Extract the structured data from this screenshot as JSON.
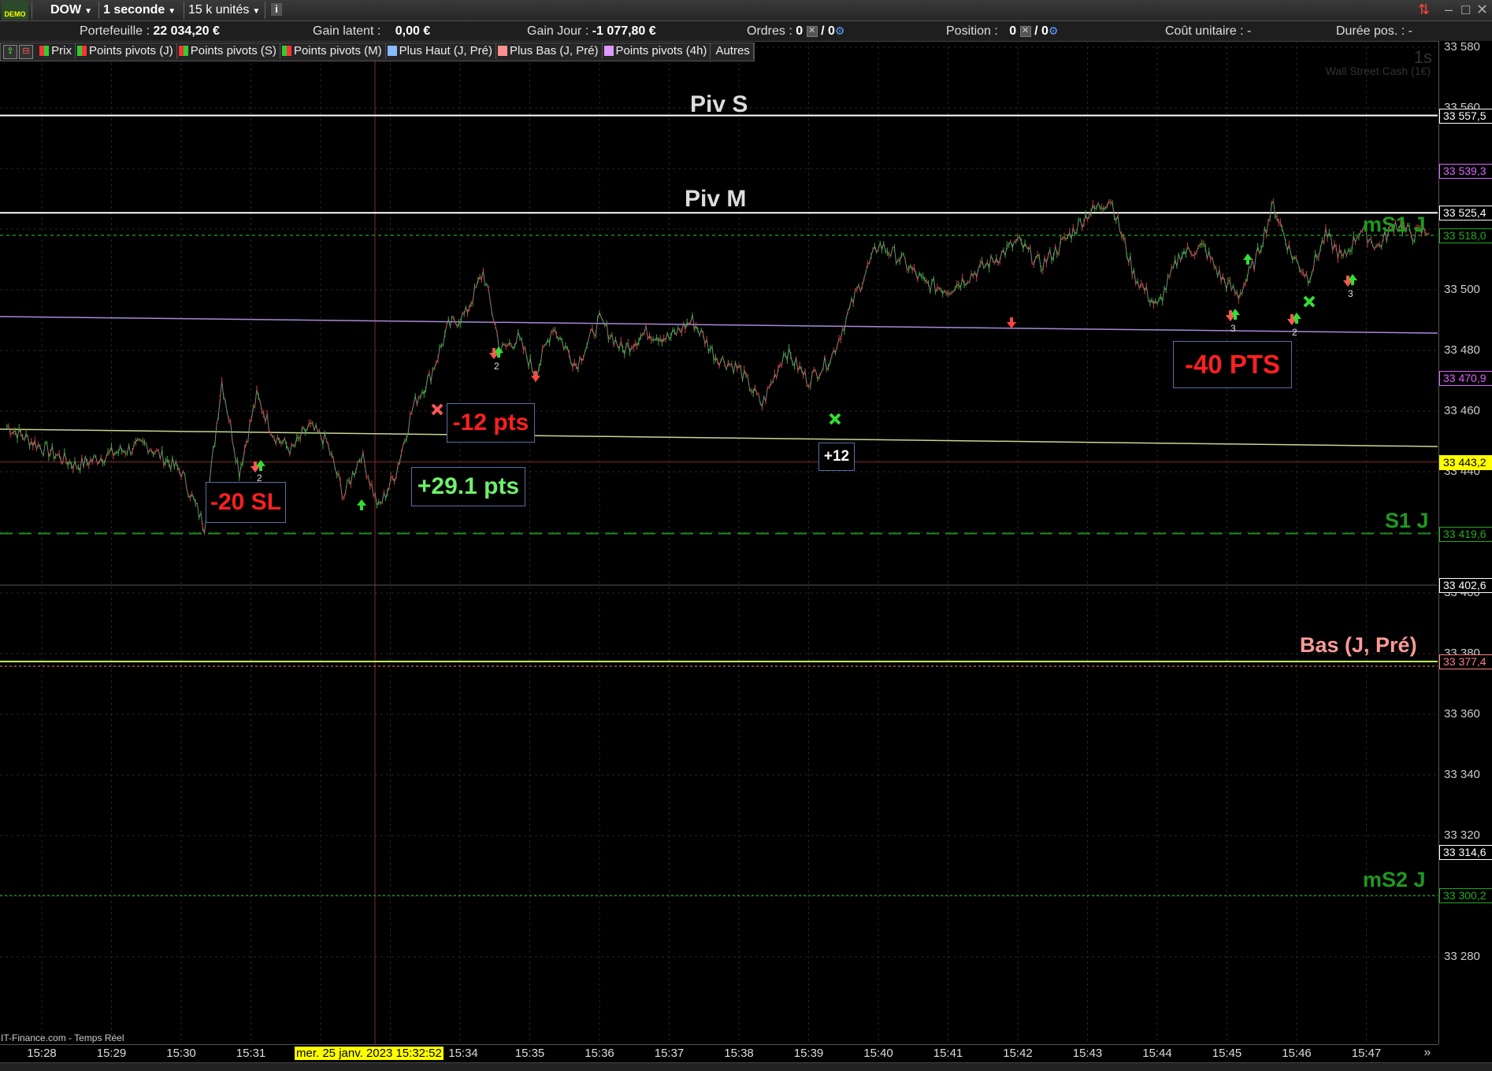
{
  "toolbar": {
    "demo_label": "DEMO",
    "instrument": "DOW",
    "period": "1 seconde",
    "units": "15 k unités",
    "info_icon": "i"
  },
  "infobar": {
    "portfolio_label": "Portefeuille :",
    "portfolio_value": "22 034,20 €",
    "latent_label": "Gain latent :",
    "latent_value": "0,00 €",
    "day_label": "Gain Jour :",
    "day_value": "-1 077,80 €",
    "orders_label": "Ordres :",
    "orders_a": "0",
    "orders_b": "/ 0",
    "position_label": "Position :",
    "position_a": "0",
    "position_b": "/ 0",
    "unit_cost_label": "Coût unitaire : -",
    "duration_label": "Durée pos. : -"
  },
  "legend": {
    "items": [
      {
        "label": "Prix",
        "color": "#33cc33"
      },
      {
        "label": "Points pivots (J)",
        "color": "#33cc33"
      },
      {
        "label": "Points pivots (S)",
        "color": "#ff3333"
      },
      {
        "label": "Points pivots (M)",
        "color": "#33cc33"
      },
      {
        "label": "Plus Haut (J, Pré)",
        "color": "#88bbff"
      },
      {
        "label": "Plus Bas (J, Pré)",
        "color": "#ff9090"
      },
      {
        "label": "Points pivots (4h)",
        "color": "#dd99ff"
      },
      {
        "label": "Autres",
        "color": ""
      }
    ]
  },
  "watermark": {
    "period": "1s",
    "instrument": "Wall Street Cash (1€)"
  },
  "chart_labels": {
    "piv_s": "Piv S",
    "piv_m": "Piv M",
    "ms1": "mS1 J",
    "s1": "S1 J",
    "bas": "Bas (J, Pré)",
    "ms2": "mS2 J"
  },
  "trade_boxes": {
    "sl20": "-20 SL",
    "pts12": "-12 pts",
    "pts29": "+29.1 pts",
    "plus12": "+12",
    "pts40": "-40 PTS"
  },
  "marker_counts": {
    "a": "2",
    "b": "2",
    "c": "3",
    "d": "2",
    "e": "3"
  },
  "price_axis": {
    "ticks": [
      "33 580",
      "33 560",
      "33 500",
      "33 480",
      "33 460",
      "33 440",
      "33 400",
      "33 380",
      "33 360",
      "33 340",
      "33 320",
      "33 280"
    ],
    "tags": [
      {
        "value": "33 557,5",
        "color": "#ffffff"
      },
      {
        "value": "33 539,3",
        "color": "#dd66ff"
      },
      {
        "value": "33 525,4",
        "color": "#ffffff"
      },
      {
        "value": "33 518,0",
        "color": "#22aa22"
      },
      {
        "value": "33 470,9",
        "color": "#dd66ff"
      },
      {
        "value": "33 443,2",
        "color": "#ffff00"
      },
      {
        "value": "33 419,6",
        "color": "#22aa22"
      },
      {
        "value": "33 402,6",
        "color": "#ffffff"
      },
      {
        "value": "33 377,4",
        "color": "#ff8080"
      },
      {
        "value": "33 314,6",
        "color": "#ffffff"
      },
      {
        "value": "33 300,2",
        "color": "#22aa22"
      }
    ]
  },
  "time_axis": {
    "ticks": [
      "15:28",
      "15:29",
      "15:30",
      "15:31",
      "15:34",
      "15:35",
      "15:36",
      "15:37",
      "15:38",
      "15:39",
      "15:40",
      "15:41",
      "15:42",
      "15:43",
      "15:44",
      "15:45",
      "15:46",
      "15:47"
    ],
    "cursor_date": "mer. 25 janv. 2023 15:32:52"
  },
  "source": "IT-Finance.com - Temps Réel",
  "chart_data": {
    "type": "line",
    "title": "",
    "x_unit": "time",
    "ylim": [
      33270,
      33585
    ],
    "x": [
      "15:27:30",
      "15:28:00",
      "15:28:30",
      "15:29:00",
      "15:29:30",
      "15:30:00",
      "15:30:20",
      "15:30:35",
      "15:30:50",
      "15:31:05",
      "15:31:20",
      "15:31:35",
      "15:31:50",
      "15:32:05",
      "15:32:20",
      "15:32:35",
      "15:32:50",
      "15:33:05",
      "15:33:20",
      "15:33:35",
      "15:33:50",
      "15:34:05",
      "15:34:20",
      "15:34:35",
      "15:34:50",
      "15:35:05",
      "15:35:20",
      "15:35:40",
      "15:36:00",
      "15:36:20",
      "15:36:40",
      "15:37:00",
      "15:37:20",
      "15:37:40",
      "15:38:00",
      "15:38:20",
      "15:38:40",
      "15:39:00",
      "15:39:20",
      "15:39:40",
      "15:40:00",
      "15:40:20",
      "15:40:40",
      "15:41:00",
      "15:41:20",
      "15:41:40",
      "15:42:00",
      "15:42:20",
      "15:42:40",
      "15:43:00",
      "15:43:20",
      "15:43:40",
      "15:44:00",
      "15:44:20",
      "15:44:40",
      "15:44:55",
      "15:45:10",
      "15:45:25",
      "15:45:40",
      "15:45:55",
      "15:46:10",
      "15:46:25",
      "15:46:40",
      "15:46:55",
      "15:47:10",
      "15:47:25",
      "15:47:40",
      "15:47:55"
    ],
    "y": [
      33455,
      33448,
      33442,
      33446,
      33449,
      33440,
      33422,
      33470,
      33440,
      33465,
      33452,
      33447,
      33455,
      33450,
      33432,
      33446,
      33428,
      33440,
      33462,
      33472,
      33488,
      33492,
      33506,
      33480,
      33484,
      33472,
      33488,
      33475,
      33490,
      33480,
      33486,
      33484,
      33490,
      33478,
      33474,
      33462,
      33480,
      33470,
      33478,
      33498,
      33515,
      33510,
      33502,
      33500,
      33505,
      33510,
      33516,
      33508,
      33516,
      33525,
      33530,
      33505,
      33494,
      33512,
      33514,
      33504,
      33498,
      33510,
      33528,
      33512,
      33504,
      33518,
      33510,
      33520,
      33514,
      33522,
      33518,
      33520
    ],
    "levels": [
      {
        "name": "Piv S",
        "value": 33557.5
      },
      {
        "name": "Piv M",
        "value": 33525.4
      },
      {
        "name": "mS1 J",
        "value": 33518.0
      },
      {
        "name": "S1 J",
        "value": 33419.6
      },
      {
        "name": "Bas (J, Pré)",
        "value": 33377.4
      },
      {
        "name": "mS2 J",
        "value": 33300.2
      }
    ]
  }
}
